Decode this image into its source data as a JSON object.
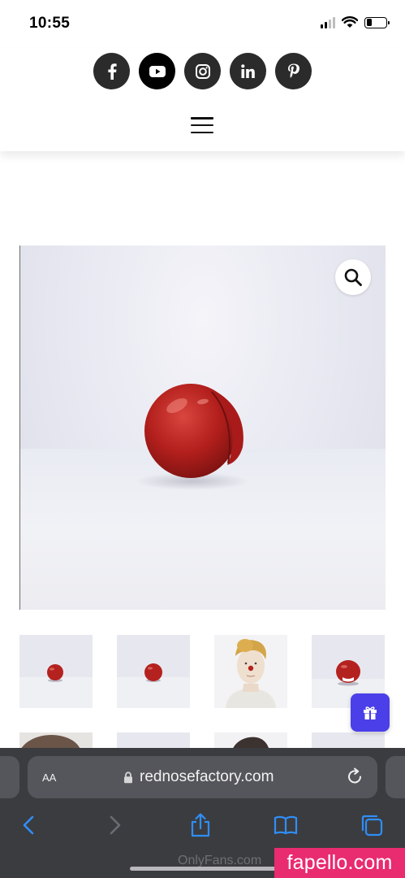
{
  "status_bar": {
    "time": "10:55",
    "battery_level": 0.3
  },
  "social_links": [
    {
      "name": "facebook",
      "icon": "facebook-icon",
      "label": "f"
    },
    {
      "name": "youtube",
      "icon": "youtube-icon",
      "active": true
    },
    {
      "name": "instagram",
      "icon": "instagram-icon"
    },
    {
      "name": "linkedin",
      "icon": "linkedin-icon",
      "label": "in"
    },
    {
      "name": "pinterest",
      "icon": "pinterest-icon",
      "label": "p"
    }
  ],
  "menu": {
    "icon": "hamburger-menu-icon"
  },
  "product": {
    "image_icon": "zoom-search-icon",
    "thumbnails_visible": 8
  },
  "gift": {
    "icon": "gift-icon",
    "color": "#4a3fe8"
  },
  "browser": {
    "text_size_label": "AA",
    "url": "rednosefactory.com",
    "lock_icon": "lock-icon",
    "reload_icon": "reload-icon",
    "toolbar": [
      "back-icon",
      "forward-icon",
      "share-icon",
      "bookmarks-icon",
      "tabs-icon"
    ],
    "accent_color": "#2f8ef7"
  },
  "watermarks": {
    "onlyfans": "OnlyFans.com",
    "fapello": "fapello.com"
  }
}
